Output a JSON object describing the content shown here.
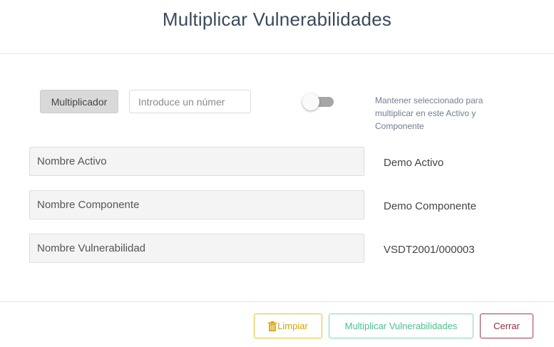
{
  "modal": {
    "title": "Multiplicar Vulnerabilidades"
  },
  "multiplier": {
    "label": "Multiplicador",
    "input_placeholder": "Introduce un númer",
    "input_value": "",
    "toggle_on": false,
    "toggle_description": "Mantener seleccionado para multiplicar en este Activo y Componente"
  },
  "fields": [
    {
      "label": "Nombre Activo",
      "value": "Demo Activo"
    },
    {
      "label": "Nombre Componente",
      "value": "Demo Componente"
    },
    {
      "label": "Nombre Vulnerabilidad",
      "value": "VSDT2001/000003"
    }
  ],
  "footer": {
    "clear_label": "Limpiar",
    "clear_icon": "trash-icon",
    "multiply_label": "Multiplicar Vulnerabilidades",
    "close_label": "Cerrar"
  },
  "colors": {
    "title": "#3a4a5c",
    "clear": "#d4a500",
    "multiply": "#4cc08c",
    "close": "#9a2a3e",
    "toggle_track": "#a6a6a6"
  }
}
